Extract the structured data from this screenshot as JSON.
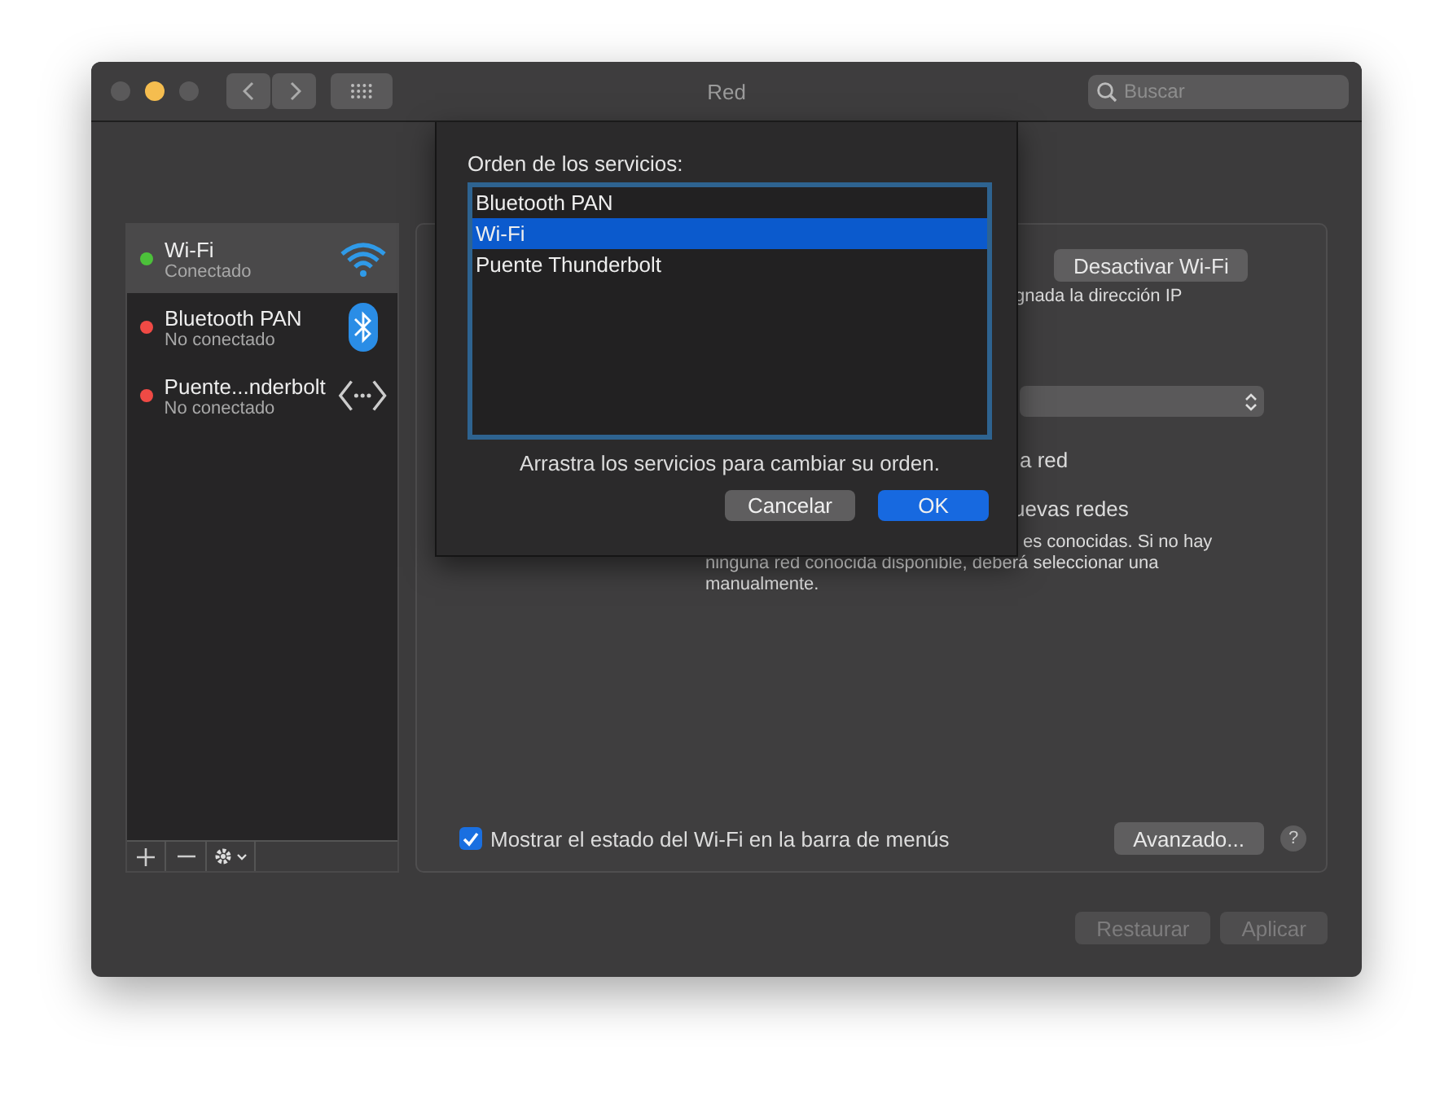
{
  "window": {
    "title": "Red",
    "search": {
      "placeholder": "Buscar"
    }
  },
  "sidebar": {
    "services": [
      {
        "name": "Wi-Fi",
        "status": "Conectado",
        "color": "#4cc13a",
        "selected": true,
        "kind": "wifi"
      },
      {
        "name": "Bluetooth PAN",
        "status": "No conectado",
        "color": "#f04a45",
        "selected": false,
        "kind": "bluetooth"
      },
      {
        "name": "Puente...nderbolt",
        "status": "No conectado",
        "color": "#f04a45",
        "selected": false,
        "kind": "bridge"
      }
    ]
  },
  "panel": {
    "toggle_button": "Desactivar Wi-Fi",
    "ip_note": "gnada la dirección IP",
    "line_1": "a red",
    "line_2": "uevas redes",
    "note_lines": [
      "es conocidas. Si no hay",
      "ninguna red conocida disponible, deberá seleccionar una",
      "manualmente."
    ],
    "menu_checkbox": {
      "label": "Mostrar el estado del Wi-Fi en la barra de menús",
      "checked": true
    },
    "advanced_button": "Avanzado...",
    "help": "?"
  },
  "footer_buttons": [
    {
      "label": "Restaurar",
      "disabled": true
    },
    {
      "label": "Aplicar",
      "disabled": true
    }
  ],
  "dialog": {
    "label": "Orden de los servicios:",
    "services": [
      {
        "label": "Bluetooth PAN",
        "selected": false
      },
      {
        "label": "Wi-Fi",
        "selected": true
      },
      {
        "label": "Puente Thunderbolt",
        "selected": false
      }
    ],
    "hint": "Arrastra los servicios para cambiar su orden.",
    "buttons": [
      {
        "label": "Cancelar",
        "kind": "cancel"
      },
      {
        "label": "OK",
        "kind": "default"
      }
    ]
  }
}
